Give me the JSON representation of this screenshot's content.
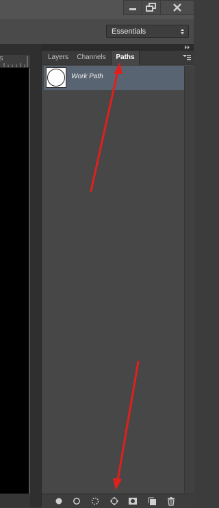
{
  "window": {
    "minimize_icon": "minimize-icon",
    "restore_icon": "restore-icon",
    "close_icon": "close-icon"
  },
  "options_bar": {
    "workspace_selected": "Essentials"
  },
  "document": {
    "ruler_label": "5"
  },
  "panel": {
    "tabs": [
      {
        "label": "Layers"
      },
      {
        "label": "Channels"
      },
      {
        "label": "Paths",
        "active": true
      }
    ],
    "paths": [
      {
        "name": "Work Path",
        "selected": true
      }
    ],
    "footer_buttons": [
      {
        "icon": "fill-path-icon"
      },
      {
        "icon": "stroke-path-icon"
      },
      {
        "icon": "load-selection-icon"
      },
      {
        "icon": "make-work-path-icon"
      },
      {
        "icon": "add-mask-icon"
      },
      {
        "icon": "new-path-icon"
      },
      {
        "icon": "delete-path-icon"
      }
    ]
  },
  "colors": {
    "selection": "#596472",
    "annotation_arrow": "#e0201c"
  }
}
